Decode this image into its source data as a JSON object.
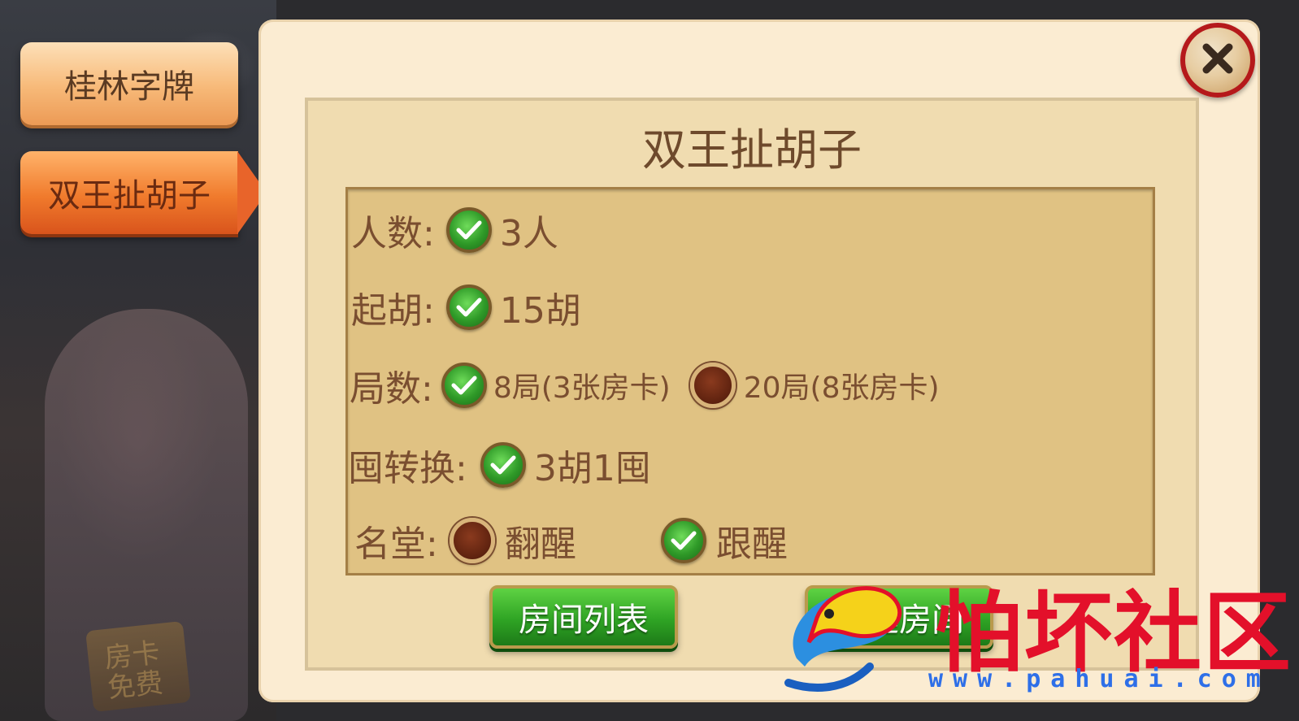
{
  "tabs": [
    {
      "label": "桂林字牌",
      "active": false
    },
    {
      "label": "双王扯胡子",
      "active": true
    }
  ],
  "background": {
    "card_label": "房卡\n免费"
  },
  "dialog": {
    "title": "双王扯胡子",
    "rows": {
      "players": {
        "label": "人数:",
        "options": [
          {
            "text": "3人",
            "checked": true
          }
        ]
      },
      "start_hu": {
        "label": "起胡:",
        "options": [
          {
            "text": "15胡",
            "checked": true
          }
        ]
      },
      "rounds": {
        "label": "局数:",
        "options": [
          {
            "text": "8局(3张房卡)",
            "checked": true
          },
          {
            "text": "20局(8张房卡)",
            "checked": false
          }
        ]
      },
      "conversion": {
        "label": "囤转换:",
        "options": [
          {
            "text": "3胡1囤",
            "checked": true
          }
        ]
      },
      "titles": {
        "label": "名堂:",
        "options": [
          {
            "text": "翻醒",
            "checked": false
          },
          {
            "text": "跟醒",
            "checked": true
          }
        ]
      }
    },
    "buttons": {
      "room_list": "房间列表",
      "create_room": "创建房间"
    }
  },
  "watermark": {
    "name": "怕坏社区",
    "url": "www.pahuai.com"
  },
  "colors": {
    "panel_bg": "#fbecd2",
    "options_bg": "#e0c283",
    "text_brown": "#7a4e30",
    "button_green": "#2fa424",
    "close_red": "#b5191b",
    "watermark_red": "#e3102a",
    "watermark_blue": "#2e6fe8"
  }
}
